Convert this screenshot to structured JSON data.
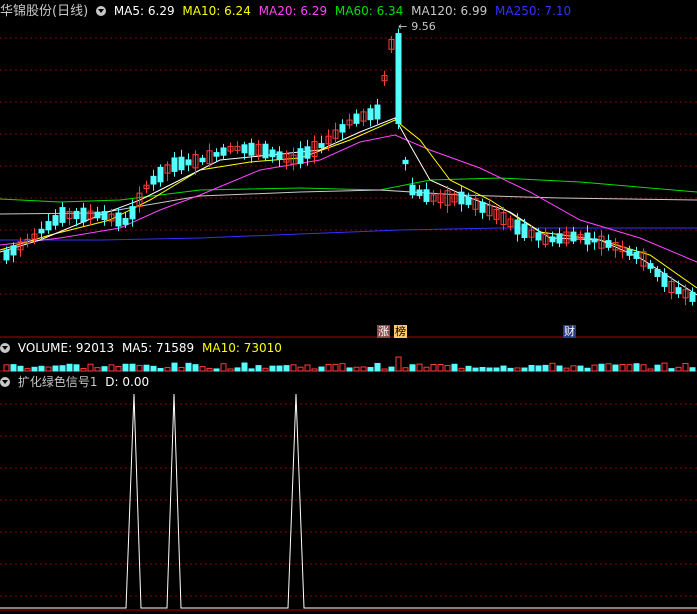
{
  "price_panel": {
    "stock_title": "华锦股份(日线)",
    "ma5": "MA5: 6.29",
    "ma10": "MA10: 6.24",
    "ma20": "MA20: 6.29",
    "ma60": "MA60: 6.34",
    "ma120": "MA120: 6.99",
    "ma250": "MA250: 7.10",
    "high_marker": "9.56",
    "tag_zhang": "涨",
    "tag_bang": "榜",
    "tag_cai": "财"
  },
  "volume_panel": {
    "volume": "VOLUME: 92013",
    "ma5": "MA5: 71589",
    "ma10": "MA10: 73010"
  },
  "indicator_panel": {
    "name": "扩化绿色信号1",
    "d": "D: 0.00"
  },
  "colors": {
    "up": "#ff3c3c",
    "down": "#54ffff",
    "ma5": "#ffffff",
    "ma10": "#ffff00",
    "ma20": "#ff44ff",
    "ma60": "#00e000",
    "ma120": "#c8c8c8",
    "ma250": "#3232ff",
    "grid": "#8b0000",
    "signal": "#ffffff"
  }
}
